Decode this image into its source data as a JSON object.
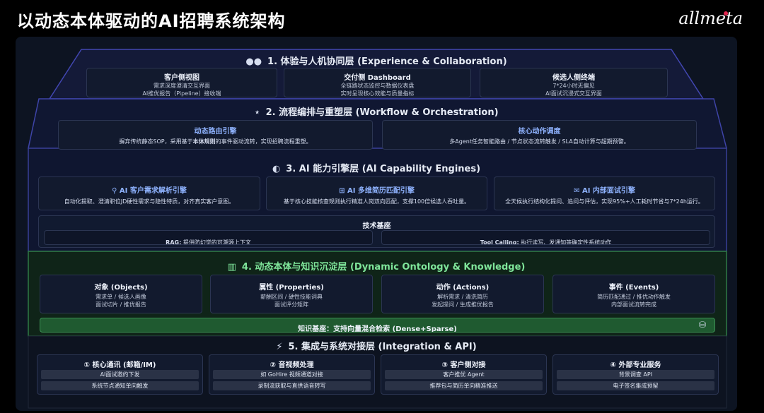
{
  "header": {
    "title": "以动态本体驱动的AI招聘系统架构",
    "logo_text": "allmeta"
  },
  "layer1": {
    "title": "1. 体验与人机协同层 (Experience & Collaboration)",
    "icon": "users-icon",
    "cards": [
      {
        "title": "客户侧视图",
        "lines": [
          "需求深度澄清交互界面",
          "AI推优报告（Pipeline）接收端"
        ]
      },
      {
        "title": "交付侧 Dashboard",
        "lines": [
          "全链路状态监控与数据仪表盘",
          "实时呈现核心效能与质量指标"
        ]
      },
      {
        "title": "候选人侧终端",
        "lines": [
          "7*24小时无偏见",
          "AI面试沉浸式交互界面"
        ]
      }
    ]
  },
  "layer2": {
    "title": "2. 流程编排与重塑层 (Workflow & Orchestration)",
    "icon": "workflow-icon",
    "cards": [
      {
        "title": "动态路由引擎",
        "desc_pre": "摒弃传统静态SOP，采用基于",
        "desc_bold": "本体规则",
        "desc_post": "的事件驱动流转，实现招聘流程重塑。"
      },
      {
        "title": "核心动作调度",
        "desc_pre": "多Agent任务智能路由 / 节点状态流转触发 / SLA自动计算与超期预警。",
        "desc_bold": "",
        "desc_post": ""
      }
    ]
  },
  "layer3": {
    "title": "3. AI 能力引擎层 (AI Capability Engines)",
    "icon": "brain-icon",
    "cards": [
      {
        "title": "AI 客户需求解析引擎",
        "icon": "search-icon",
        "desc": "自动化提取、澄清职位JD硬性需求与隐性特质，对齐真实客户意图。"
      },
      {
        "title": "AI 多维简历匹配引擎",
        "icon": "grid-icon",
        "desc": "基于核心技能核查规则执行精准人岗双向匹配，支撑100倍候选人吞吐量。"
      },
      {
        "title": "AI 内部面试引擎",
        "icon": "chat-icon",
        "desc": "全天候执行结构化提问、追问与评估，实现95%+人工耗时节省与7*24h运行。"
      }
    ],
    "tech": {
      "title": "技术基座",
      "left_label": "RAG:",
      "left_text": "提供防幻觉的可溯源上下文",
      "right_label": "Tool Calling:",
      "right_text": "执行读写、发通知等确定性系统动作"
    }
  },
  "layer4": {
    "title": "4. 动态本体与知识沉淀层 (Dynamic Ontology & Knowledge)",
    "icon": "hierarchy-icon",
    "cards": [
      {
        "title": "对象 (Objects)",
        "lines": [
          "需求单 / 候选人画像",
          "面试切片 / 推优报告"
        ]
      },
      {
        "title": "属性 (Properties)",
        "lines": [
          "薪酬区间 / 硬性技能词典",
          "面试评分矩阵"
        ]
      },
      {
        "title": "动作 (Actions)",
        "lines": [
          "解析需求 / 清洗简历",
          "发起提问 / 生成推优报告"
        ]
      },
      {
        "title": "事件 (Events)",
        "lines": [
          "简历匹配通过 / 推优动作触发",
          "内部面试流转完成"
        ]
      }
    ],
    "kb": {
      "label": "知识基座：",
      "text": "支持向量混合检索 (Dense+Sparse)"
    }
  },
  "layer5": {
    "title": "5. 集成与系统对接层 (Integration & API)",
    "icon": "plug-icon",
    "cards": [
      {
        "title": "① 核心通讯 (邮箱/IM)",
        "items": [
          "AI面试邀约下发",
          "系统节点通知单向触发"
        ]
      },
      {
        "title": "② 音视频处理",
        "items": [
          "如 GoHire 视频通道对接",
          "录制流获取与直供语音转写"
        ]
      },
      {
        "title": "③ 客户侧对接",
        "items": [
          "客户推优 Agent",
          "推荐包与简历单向精准推送"
        ]
      },
      {
        "title": "④ 外部专业服务",
        "items": [
          "背景调查 API",
          "电子签名集成预留"
        ]
      }
    ]
  },
  "colors": {
    "accent_blue": "#8fb3ff",
    "green_layer": "#2f7a45",
    "purple_border": "#4a4fc2"
  }
}
